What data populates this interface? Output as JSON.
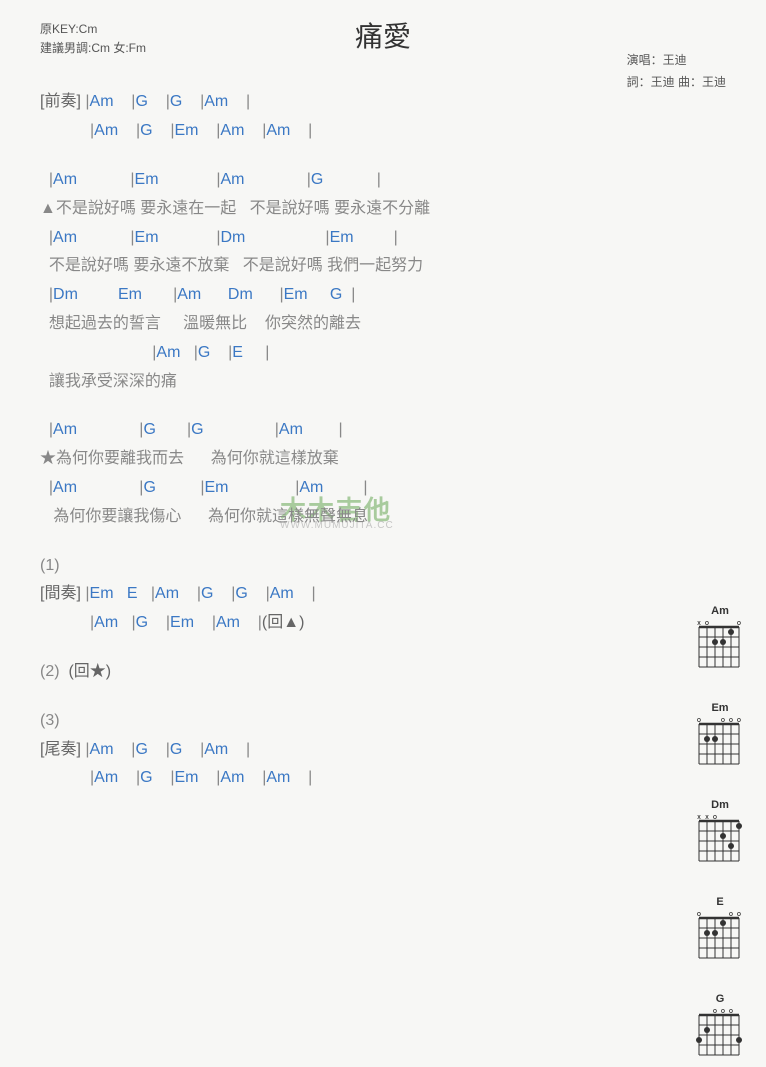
{
  "header": {
    "original_key": "原KEY:Cm",
    "suggested_key": "建議男調:Cm 女:Fm",
    "title": "痛愛",
    "performer": "演唱：王迪",
    "credits": "詞：王迪  曲：王迪"
  },
  "watermark": {
    "main": "木木吉他",
    "sub": "WWW.MUMUJITA.CC"
  },
  "sections": {
    "intro_label": "[前奏]",
    "interlude_label": "[間奏]",
    "outro_label": "[尾奏]",
    "return_tri": "(回▲)",
    "return_star": "(回★)",
    "num1": "(1)",
    "num2": "(2)",
    "num3": "(3)"
  },
  "chords": {
    "Am": "Am",
    "G": "G",
    "Em": "Em",
    "Dm": "Dm",
    "E": "E"
  },
  "lyrics": {
    "l1a": "▲不是說好嗎 要永遠在一起",
    "l1b": "不是說好嗎 要永遠不分離",
    "l2a": "不是說好嗎 要永遠不放棄",
    "l2b": "不是說好嗎 我們一起努力",
    "l3a": "想起過去的誓言",
    "l3b": "溫暖無比",
    "l3c": "你突然的離去",
    "l4": "讓我承受深深的痛",
    "l5a": "★為何你要離我而去",
    "l5b": "為何你就這樣放棄",
    "l6a": "為何你要讓我傷心",
    "l6b": "為何你就這樣無聲無息"
  },
  "diagram_labels": {
    "Am": "Am",
    "Em": "Em",
    "Dm": "Dm",
    "E": "E",
    "G": "G"
  }
}
